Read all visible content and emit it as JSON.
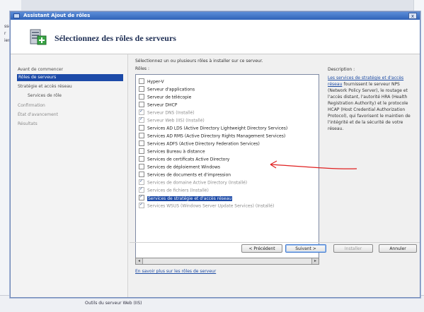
{
  "background": {
    "left_strip_lines": [
      "ssc",
      "r",
      "ier"
    ],
    "bottom_status": "Outils du serveur Web (IIS)"
  },
  "window": {
    "title": "Assistant Ajout de rôles",
    "close": "x"
  },
  "header": {
    "heading": "Sélectionnez des rôles de serveurs"
  },
  "nav": {
    "items": [
      "Avant de commencer",
      "Rôles de serveurs",
      "Stratégie et accès réseau",
      "Services de rôle",
      "Confirmation",
      "État d'avancement",
      "Résultats"
    ]
  },
  "content": {
    "instruction": "Sélectionnez un ou plusieurs rôles à installer sur ce serveur.",
    "roles_label": "Rôles :",
    "roles": [
      {
        "label": "Hyper-V",
        "checked": false,
        "disabled": false,
        "selected": false
      },
      {
        "label": "Serveur d'applications",
        "checked": false,
        "disabled": false,
        "selected": false
      },
      {
        "label": "Serveur de télécopie",
        "checked": false,
        "disabled": false,
        "selected": false
      },
      {
        "label": "Serveur DHCP",
        "checked": false,
        "disabled": false,
        "selected": false
      },
      {
        "label": "Serveur DNS (Installé)",
        "checked": true,
        "disabled": true,
        "selected": false
      },
      {
        "label": "Serveur Web (IIS) (Installé)",
        "checked": true,
        "disabled": true,
        "selected": false
      },
      {
        "label": "Services AD LDS (Active Directory Lightweight Directory Services)",
        "checked": false,
        "disabled": false,
        "selected": false
      },
      {
        "label": "Services AD RMS (Active Directory Rights Management Services)",
        "checked": false,
        "disabled": false,
        "selected": false
      },
      {
        "label": "Services ADFS (Active Directory Federation Services)",
        "checked": false,
        "disabled": false,
        "selected": false
      },
      {
        "label": "Services Bureau à distance",
        "checked": false,
        "disabled": false,
        "selected": false
      },
      {
        "label": "Services de certificats Active Directory",
        "checked": false,
        "disabled": false,
        "selected": false
      },
      {
        "label": "Services de déploiement Windows",
        "checked": false,
        "disabled": false,
        "selected": false
      },
      {
        "label": "Services de documents et d'impression",
        "checked": false,
        "disabled": false,
        "selected": false
      },
      {
        "label": "Services de domaine Active Directory (Installé)",
        "checked": true,
        "disabled": true,
        "selected": false
      },
      {
        "label": "Services de fichiers (Installé)",
        "checked": true,
        "disabled": true,
        "selected": false
      },
      {
        "label": "Services de stratégie et d'accès réseau",
        "checked": true,
        "disabled": false,
        "selected": true
      },
      {
        "label": "Services WSUS (Windows Server Update Services) (Installé)",
        "checked": true,
        "disabled": true,
        "selected": false
      }
    ],
    "description_label": "Description :",
    "description_link": "Les services de stratégie et d'accès réseau",
    "description_body": "fournissent le serveur NPS (Network Policy Server), le routage et l'accès distant, l'autorité HRA (Health Registration Authority) et le protocole HCAP (Host Credential Authorization Protocol), qui favorisent le maintien de l'intégrité et de la sécurité de votre réseau.",
    "more_link": "En savoir plus sur les rôles de serveur"
  },
  "buttons": {
    "previous": "< Précédent",
    "next": "Suivant >",
    "install": "Installer",
    "cancel": "Annuler"
  },
  "annotation_color": "#e02020"
}
